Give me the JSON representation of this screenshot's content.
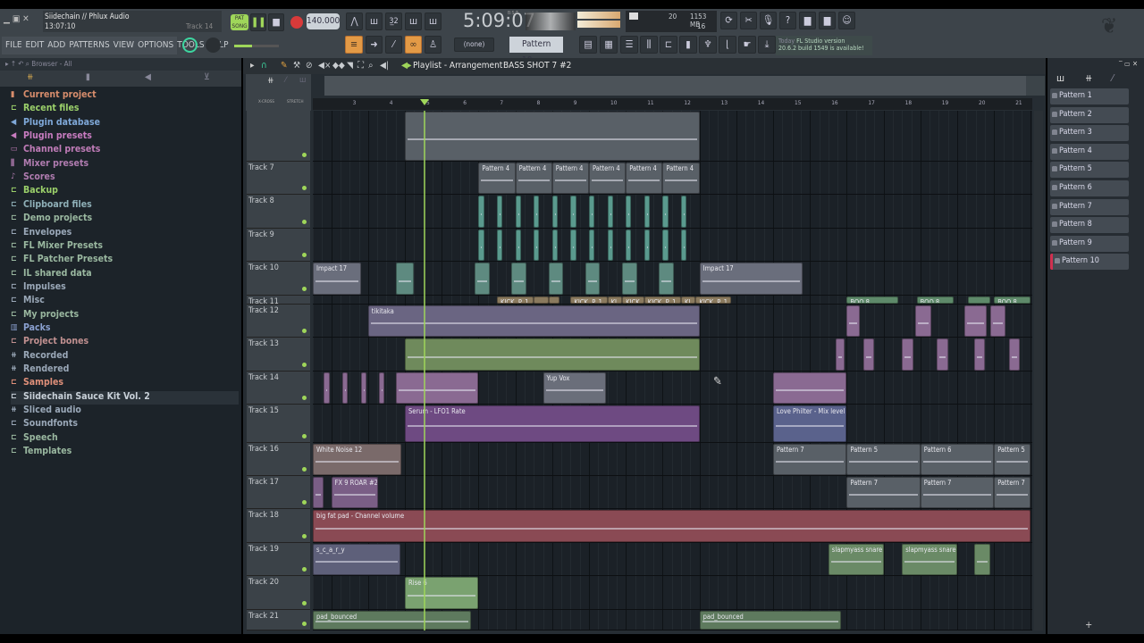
{
  "window": {
    "title": "Siidechain // Phlux Audio",
    "time": "13:07:10",
    "hint": "Track 14"
  },
  "menu": [
    "FILE",
    "EDIT",
    "ADD",
    "PATTERNS",
    "VIEW",
    "OPTIONS",
    "TOOLS",
    "HELP"
  ],
  "transport": {
    "mode_pat": "PAT",
    "mode_song": "SONG",
    "tempo": "140.000",
    "song_time": "5:09:07",
    "time_format": "B:S:T",
    "cpu": "20",
    "memory": "1153 MB",
    "polyphony": "16"
  },
  "toolbar": {
    "channel_select": "(none)",
    "pattern_select": "Pattern 10",
    "news_day": "Today",
    "news_line1": "FL Studio version",
    "news_line2": "20.6.2 build 1549 is available!"
  },
  "browser": {
    "title": "Browser - All",
    "items": [
      {
        "label": "Current project",
        "color": "#d88d6c",
        "icon": "page"
      },
      {
        "label": "Recent files",
        "color": "#9bd06a",
        "icon": "folder-arrow"
      },
      {
        "label": "Plugin database",
        "color": "#7fa8d8",
        "icon": "plug"
      },
      {
        "label": "Plugin presets",
        "color": "#c87cc0",
        "icon": "plug"
      },
      {
        "label": "Channel presets",
        "color": "#c07cb8",
        "icon": "channel"
      },
      {
        "label": "Mixer presets",
        "color": "#b07cb0",
        "icon": "mixer"
      },
      {
        "label": "Scores",
        "color": "#b07cb0",
        "icon": "note"
      },
      {
        "label": "Backup",
        "color": "#9bd06a",
        "icon": "folder-arrow"
      },
      {
        "label": "Clipboard files",
        "color": "#8fb0b8",
        "icon": "folder"
      },
      {
        "label": "Demo projects",
        "color": "#9ab8a0",
        "icon": "folder"
      },
      {
        "label": "Envelopes",
        "color": "#9aa8b8",
        "icon": "folder"
      },
      {
        "label": "FL Mixer Presets",
        "color": "#9ab8a0",
        "icon": "folder"
      },
      {
        "label": "FL Patcher Presets",
        "color": "#9ab8a0",
        "icon": "folder"
      },
      {
        "label": "IL shared data",
        "color": "#9ab8a0",
        "icon": "folder"
      },
      {
        "label": "Impulses",
        "color": "#9aa8b8",
        "icon": "folder"
      },
      {
        "label": "Misc",
        "color": "#9aa8b8",
        "icon": "folder"
      },
      {
        "label": "My projects",
        "color": "#9ab8a0",
        "icon": "folder"
      },
      {
        "label": "Packs",
        "color": "#8aa0d0",
        "icon": "packs"
      },
      {
        "label": "Project bones",
        "color": "#c09090",
        "icon": "folder"
      },
      {
        "label": "Recorded",
        "color": "#9aa8b8",
        "icon": "wave"
      },
      {
        "label": "Rendered",
        "color": "#9aa8b8",
        "icon": "wave"
      },
      {
        "label": "Samples",
        "color": "#e0907a",
        "icon": "folder"
      },
      {
        "label": "Siidechain Sauce Kit Vol. 2",
        "color": "#c8d0d8",
        "icon": "folder"
      },
      {
        "label": "Sliced audio",
        "color": "#9aa8b8",
        "icon": "wave"
      },
      {
        "label": "Soundfonts",
        "color": "#9aa8b8",
        "icon": "folder"
      },
      {
        "label": "Speech",
        "color": "#9ab8a0",
        "icon": "folder"
      },
      {
        "label": "Templates",
        "color": "#9ab8a0",
        "icon": "folder"
      }
    ]
  },
  "playlist": {
    "title": "Playlist - Arrangement",
    "current_clip": "BASS SHOT 7 #2",
    "xcross": "X-CROSS",
    "stretch": "STRETCH",
    "ruler": [
      "3",
      "4",
      "5",
      "6",
      "7",
      "8",
      "9",
      "10",
      "11",
      "12",
      "13",
      "14",
      "15",
      "16",
      "17",
      "18",
      "19",
      "20",
      "21"
    ],
    "playhead_bar": 5.5,
    "tracks": [
      {
        "label": "",
        "clips": [
          {
            "s": 5,
            "e": 13,
            "name": "",
            "color": "#596067"
          }
        ]
      },
      {
        "label": "Track 7",
        "clips": [
          {
            "s": 7,
            "e": 8,
            "name": "Pattern 4",
            "color": "#596067"
          },
          {
            "s": 8,
            "e": 9,
            "name": "Pattern 4",
            "color": "#596067"
          },
          {
            "s": 9,
            "e": 10,
            "name": "Pattern 4",
            "color": "#596067"
          },
          {
            "s": 10,
            "e": 11,
            "name": "Pattern 4",
            "color": "#596067"
          },
          {
            "s": 11,
            "e": 12,
            "name": "Pattern 4",
            "color": "#596067"
          },
          {
            "s": 12,
            "e": 13,
            "name": "Pattern 4",
            "color": "#596067"
          }
        ]
      },
      {
        "label": "Track 8",
        "clips": [
          {
            "s": 7,
            "e": 7.15,
            "name": "",
            "color": "#5a9a8e"
          },
          {
            "s": 7.5,
            "e": 7.65,
            "name": "",
            "color": "#5a9a8e"
          },
          {
            "s": 8,
            "e": 8.15,
            "name": "",
            "color": "#5a9a8e"
          },
          {
            "s": 8.5,
            "e": 8.65,
            "name": "",
            "color": "#5a9a8e"
          },
          {
            "s": 9,
            "e": 9.15,
            "name": "",
            "color": "#5a9a8e"
          },
          {
            "s": 9.5,
            "e": 9.65,
            "name": "",
            "color": "#5a9a8e"
          },
          {
            "s": 10,
            "e": 10.15,
            "name": "",
            "color": "#5a9a8e"
          },
          {
            "s": 10.5,
            "e": 10.65,
            "name": "",
            "color": "#5a9a8e"
          },
          {
            "s": 11,
            "e": 11.15,
            "name": "",
            "color": "#5a9a8e"
          },
          {
            "s": 11.5,
            "e": 11.65,
            "name": "",
            "color": "#5a9a8e"
          },
          {
            "s": 12,
            "e": 12.15,
            "name": "",
            "color": "#5a9a8e"
          },
          {
            "s": 12.5,
            "e": 12.65,
            "name": "",
            "color": "#5a9a8e"
          }
        ]
      },
      {
        "label": "Track 9",
        "clips": [
          {
            "s": 7,
            "e": 7.15,
            "name": "",
            "color": "#5a9a8e"
          },
          {
            "s": 7.5,
            "e": 7.65,
            "name": "",
            "color": "#5a9a8e"
          },
          {
            "s": 8,
            "e": 8.15,
            "name": "",
            "color": "#5a9a8e"
          },
          {
            "s": 8.5,
            "e": 8.65,
            "name": "",
            "color": "#5a9a8e"
          },
          {
            "s": 9,
            "e": 9.15,
            "name": "",
            "color": "#5a9a8e"
          },
          {
            "s": 9.5,
            "e": 9.65,
            "name": "",
            "color": "#5a9a8e"
          },
          {
            "s": 10,
            "e": 10.15,
            "name": "",
            "color": "#5a9a8e"
          },
          {
            "s": 10.5,
            "e": 10.65,
            "name": "",
            "color": "#5a9a8e"
          },
          {
            "s": 11,
            "e": 11.15,
            "name": "",
            "color": "#5a9a8e"
          },
          {
            "s": 11.5,
            "e": 11.65,
            "name": "",
            "color": "#5a9a8e"
          },
          {
            "s": 12,
            "e": 12.15,
            "name": "",
            "color": "#5a9a8e"
          },
          {
            "s": 12.5,
            "e": 12.65,
            "name": "",
            "color": "#5a9a8e"
          }
        ]
      },
      {
        "label": "Track 10",
        "clips": [
          {
            "s": 2.5,
            "e": 3.8,
            "name": "Impact 17",
            "color": "#6a6e7c"
          },
          {
            "s": 4.75,
            "e": 5.25,
            "name": "",
            "color": "#5e8a80"
          },
          {
            "s": 6.9,
            "e": 7.3,
            "name": "",
            "color": "#5e8a80"
          },
          {
            "s": 7.9,
            "e": 8.3,
            "name": "",
            "color": "#5e8a80"
          },
          {
            "s": 8.9,
            "e": 9.3,
            "name": "",
            "color": "#5e8a80"
          },
          {
            "s": 9.9,
            "e": 10.3,
            "name": "",
            "color": "#5e8a80"
          },
          {
            "s": 10.9,
            "e": 11.3,
            "name": "",
            "color": "#5e8a80"
          },
          {
            "s": 11.9,
            "e": 12.3,
            "name": "",
            "color": "#5e8a80"
          },
          {
            "s": 13,
            "e": 15.8,
            "name": "Impact 17",
            "color": "#6a6e7c"
          }
        ]
      },
      {
        "label": "Track 11",
        "clips": [
          {
            "s": 7.5,
            "e": 8.5,
            "name": "KICK..P_1",
            "color": "#8a7a5e"
          },
          {
            "s": 8.5,
            "e": 8.9,
            "name": "",
            "color": "#8a7a5e"
          },
          {
            "s": 8.9,
            "e": 9.2,
            "name": "",
            "color": "#8a7a5e"
          },
          {
            "s": 9.5,
            "e": 10.5,
            "name": "KICK..P_1",
            "color": "#8a7a5e"
          },
          {
            "s": 10.5,
            "e": 10.9,
            "name": "KI",
            "color": "#8a7a5e"
          },
          {
            "s": 10.9,
            "e": 11.5,
            "name": "KICK..",
            "color": "#8a7a5e"
          },
          {
            "s": 11.5,
            "e": 12.5,
            "name": "KICK..P_1",
            "color": "#8a7a5e"
          },
          {
            "s": 12.5,
            "e": 12.9,
            "name": "KI",
            "color": "#8a7a5e"
          },
          {
            "s": 12.9,
            "e": 13.85,
            "name": "KICK..P_1",
            "color": "#8a7a5e"
          },
          {
            "s": 17,
            "e": 18.4,
            "name": "BOO 8",
            "color": "#5e8a6a"
          },
          {
            "s": 18.9,
            "e": 19.9,
            "name": "BOO 8",
            "color": "#5e8a6a"
          },
          {
            "s": 20.3,
            "e": 20.9,
            "name": "",
            "color": "#5e8a6a"
          },
          {
            "s": 21,
            "e": 22,
            "name": "BOO 8",
            "color": "#5e8a6a"
          }
        ]
      },
      {
        "label": "Track 12",
        "clips": [
          {
            "s": 4,
            "e": 13,
            "name": "tikitaka",
            "color": "#6a6582"
          },
          {
            "s": 17,
            "e": 17.35,
            "name": "",
            "color": "#8a6a92"
          },
          {
            "s": 18.85,
            "e": 19.3,
            "name": "",
            "color": "#8a6a92"
          },
          {
            "s": 20.2,
            "e": 20.8,
            "name": "",
            "color": "#8a6a92"
          },
          {
            "s": 20.9,
            "e": 21.3,
            "name": "",
            "color": "#8a6a92"
          }
        ]
      },
      {
        "label": "Track 13",
        "clips": [
          {
            "s": 5,
            "e": 13,
            "name": "",
            "color": "#6f8a5c"
          },
          {
            "s": 16.7,
            "e": 16.95,
            "name": "",
            "color": "#8a6a92"
          },
          {
            "s": 17.45,
            "e": 17.75,
            "name": "",
            "color": "#8a6a92"
          },
          {
            "s": 18.5,
            "e": 18.8,
            "name": "",
            "color": "#8a6a92"
          },
          {
            "s": 19.45,
            "e": 19.75,
            "name": "",
            "color": "#8a6a92"
          },
          {
            "s": 20.45,
            "e": 20.75,
            "name": "",
            "color": "#8a6a92"
          },
          {
            "s": 21.4,
            "e": 21.7,
            "name": "",
            "color": "#8a6a92"
          }
        ]
      },
      {
        "label": "Track 14",
        "clips": [
          {
            "s": 2.8,
            "e": 2.95,
            "name": "",
            "color": "#8a6a92"
          },
          {
            "s": 3.3,
            "e": 3.45,
            "name": "",
            "color": "#8a6a92"
          },
          {
            "s": 3.8,
            "e": 3.95,
            "name": "",
            "color": "#8a6a92"
          },
          {
            "s": 4.3,
            "e": 4.45,
            "name": "",
            "color": "#8a6a92"
          },
          {
            "s": 4.75,
            "e": 7,
            "name": "",
            "color": "#8a6a92"
          },
          {
            "s": 8.75,
            "e": 10.45,
            "name": "Yup Vox",
            "color": "#6a6e7a"
          },
          {
            "s": 15,
            "e": 17,
            "name": "",
            "color": "#8a6a92"
          }
        ]
      },
      {
        "label": "Track 15",
        "clips": [
          {
            "s": 5,
            "e": 13,
            "name": "Serum - LFO1 Rate",
            "color": "#6e4a82"
          },
          {
            "s": 15,
            "e": 17,
            "name": "Love Philter - Mix level",
            "color": "#5a628c"
          }
        ]
      },
      {
        "label": "Track 16",
        "clips": [
          {
            "s": 2.5,
            "e": 4.9,
            "name": "White Noise 12",
            "color": "#7a6a6a"
          },
          {
            "s": 15,
            "e": 17,
            "name": "Pattern 7",
            "color": "#596067"
          },
          {
            "s": 17,
            "e": 19,
            "name": "Pattern 5",
            "color": "#596067"
          },
          {
            "s": 19,
            "e": 21,
            "name": "Pattern 6",
            "color": "#596067"
          },
          {
            "s": 21,
            "e": 22,
            "name": "Pattern 5",
            "color": "#596067"
          }
        ]
      },
      {
        "label": "Track 17",
        "clips": [
          {
            "s": 2.5,
            "e": 2.8,
            "name": "",
            "color": "#7a5e86"
          },
          {
            "s": 3,
            "e": 4.27,
            "name": "FX 9 ROAR #2",
            "color": "#7a5e86"
          },
          {
            "s": 17,
            "e": 19,
            "name": "Pattern 7",
            "color": "#596067"
          },
          {
            "s": 19,
            "e": 21,
            "name": "Pattern 7",
            "color": "#596067"
          },
          {
            "s": 21,
            "e": 22,
            "name": "Pattern 7",
            "color": "#596067"
          }
        ]
      },
      {
        "label": "Track 18",
        "clips": [
          {
            "s": 2.5,
            "e": 22,
            "name": "big fat pad - Channel volume",
            "color": "#8a4a54"
          }
        ]
      },
      {
        "label": "Track 19",
        "clips": [
          {
            "s": 2.5,
            "e": 4.88,
            "name": "s_c_a_r_y",
            "color": "#5e607a"
          },
          {
            "s": 16.5,
            "e": 18,
            "name": "slapmyass snare",
            "color": "#6a8a66"
          },
          {
            "s": 18.5,
            "e": 20,
            "name": "slapmyass snare",
            "color": "#6a8a66"
          },
          {
            "s": 20.46,
            "e": 20.9,
            "name": "",
            "color": "#6a8a66"
          }
        ]
      },
      {
        "label": "Track 20",
        "clips": [
          {
            "s": 5,
            "e": 7,
            "name": "Rise 6",
            "color": "#7aa270"
          }
        ]
      },
      {
        "label": "Track 21",
        "clips": [
          {
            "s": 2.5,
            "e": 6.8,
            "name": "pad_bounced",
            "color": "#5e7a5e"
          },
          {
            "s": 13,
            "e": 16.85,
            "name": "pad_bounced",
            "color": "#5e7a5e"
          }
        ]
      }
    ]
  },
  "picker": {
    "patterns": [
      "Pattern 1",
      "Pattern 2",
      "Pattern 3",
      "Pattern 4",
      "Pattern 5",
      "Pattern 6",
      "Pattern 7",
      "Pattern 8",
      "Pattern 9",
      "Pattern 10"
    ],
    "selected": "Pattern 10"
  },
  "colors": {
    "accent_orange": "#e39a46",
    "playhead": "#9fd65a",
    "record": "#d83a3a"
  }
}
